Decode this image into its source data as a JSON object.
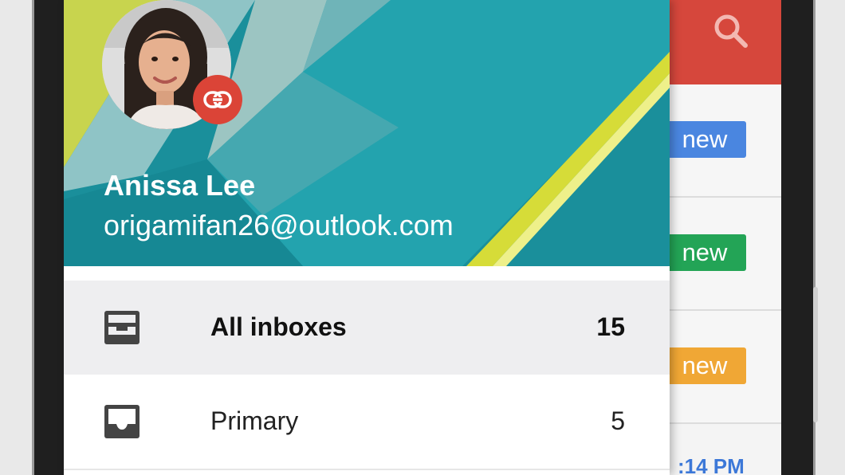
{
  "drawer": {
    "account": {
      "name": "Anissa Lee",
      "email": "origamifan26@outlook.com",
      "badge_icon": "link-icon",
      "badge_color": "#db4437"
    },
    "items": [
      {
        "label": "All inboxes",
        "count": "15",
        "icon": "all-inboxes-icon",
        "selected": true
      },
      {
        "label": "Primary",
        "count": "5",
        "icon": "inbox-icon",
        "selected": false
      }
    ]
  },
  "background": {
    "toolbar_color": "#d6473c",
    "search_icon": "search-icon",
    "badges": [
      {
        "label": "new",
        "color": "#4a86e0"
      },
      {
        "label": "new",
        "color": "#23a456"
      },
      {
        "label": "new",
        "color": "#f0a735"
      }
    ],
    "partial_time": ":14 PM"
  },
  "colors": {
    "header_teal": "#1a8f9b",
    "accent_yellow": "#c9d635"
  }
}
